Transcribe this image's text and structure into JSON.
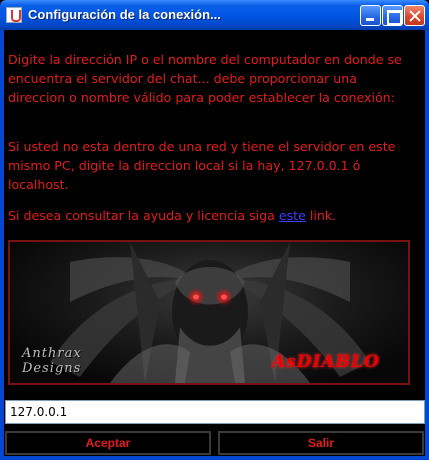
{
  "window": {
    "title": "Configuración de la conexión...",
    "app_icon": "java-cup-icon",
    "controls": [
      "minimize-icon",
      "maximize-icon",
      "close-icon"
    ]
  },
  "instructions": {
    "paragraph1": "Digite la dirección IP o el nombre del computador en donde se encuentra el servidor del chat... debe proporcionar una direccion o nombre válido para poder establecer la conexión:",
    "paragraph2": "Si usted no esta dentro de una red y tiene el servidor en este mismo PC, digite la direccion local si la hay, 127.0.0.1 ó localhost.",
    "paragraph3_before": "Si desea consultar la ayuda y licencia siga ",
    "help_link": "este",
    "paragraph3_after": " link."
  },
  "banner": {
    "signature_left_line1": "Anthrax",
    "signature_left_line2": "Designs",
    "signature_right": "AsDIABLO"
  },
  "connection": {
    "address_value": "127.0.0.1"
  },
  "buttons": {
    "accept_label": "Aceptar",
    "exit_label": "Salir"
  },
  "colors": {
    "background": "#000000",
    "text": "#e41b1b",
    "link": "#3d3dff",
    "titlebar": "#0054e3"
  }
}
